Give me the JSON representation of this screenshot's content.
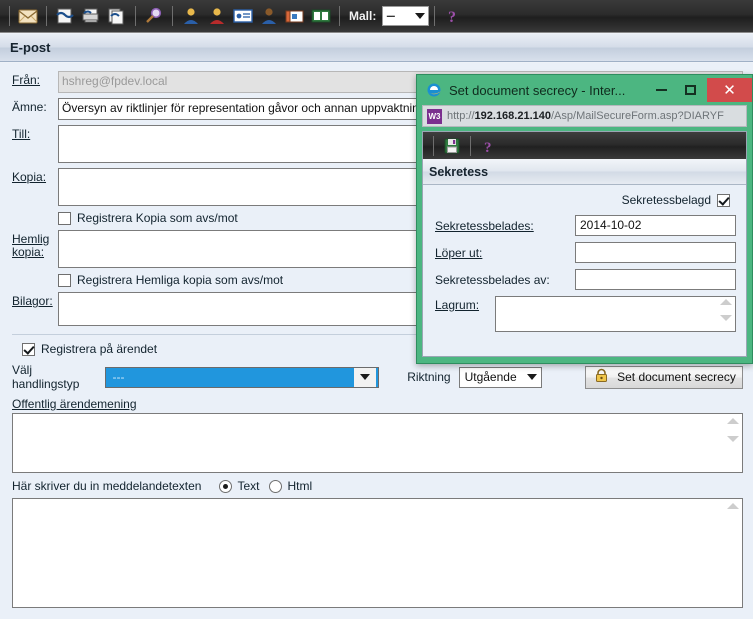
{
  "toolbar": {
    "icons": [
      {
        "name": "mail-icon",
        "title": "E-post"
      },
      {
        "name": "document-link-icon",
        "title": "Handling"
      },
      {
        "name": "document-print-icon",
        "title": "Skriv ut"
      },
      {
        "name": "documents-copy-icon",
        "title": "Kopiera"
      },
      {
        "name": "search-icon",
        "title": "Sök"
      },
      {
        "name": "user-blue-icon",
        "title": "Person"
      },
      {
        "name": "user-red-icon",
        "title": "Person"
      },
      {
        "name": "contact-card-icon",
        "title": "Kontaktkort"
      },
      {
        "name": "user-avatar-icon",
        "title": "Användare"
      },
      {
        "name": "cards-stack-icon",
        "title": "Register"
      },
      {
        "name": "book-icon",
        "title": "Katalog"
      }
    ],
    "mall_label": "Mall:",
    "mall_value": "---",
    "help_icon": "help-question-icon"
  },
  "panel": {
    "title": "E-post"
  },
  "form": {
    "fran_label": "Från:",
    "fran_value": "hshreg@fpdev.local",
    "amne_label": "Ämne:",
    "amne_value": "Översyn av riktlinjer för representation gåvor och annan uppvaktning frå",
    "till_label": "Till:",
    "till_value": "",
    "kopia_label": "Kopia:",
    "kopia_value": "",
    "reg_kopia_label": "Registrera Kopia som avs/mot",
    "reg_kopia_checked": false,
    "hemlig_kopia_label_1": "Hemlig",
    "hemlig_kopia_label_2": "kopia:",
    "hemlig_kopia_value": "",
    "reg_hemlig_label": "Registrera Hemliga kopia som avs/mot",
    "reg_hemlig_checked": false,
    "bilagor_label": "Bilagor:",
    "bilagor_value": "",
    "registrera_arendet_label": "Registrera på ärendet",
    "registrera_arendet_checked": true,
    "valj_handlingstyp_label": "Välj handlingstyp",
    "valj_handlingstyp_value": "---",
    "riktning_label": "Riktning",
    "riktning_value": "Utgående",
    "set_secrecy_button": "Set document secrecy",
    "set_secrecy_icon": "lock-icon",
    "offentlig_label": "Offentlig ärendemening",
    "offentlig_value": "",
    "meddelande_label": "Här skriver du in meddelandetexten",
    "format_text_label": "Text",
    "format_html_label": "Html",
    "format_selected": "Text",
    "meddelande_value": ""
  },
  "dialog": {
    "title": "Set document secrecy - Inter...",
    "browser_icon": "internet-explorer-icon",
    "minimize_icon": "minimize-icon",
    "maximize_icon": "maximize-icon",
    "close_icon": "close-icon",
    "url_icon": "w3-page-icon",
    "url_prefix": "http://",
    "url_host": "192.168.21.140",
    "url_path": "/Asp/MailSecureForm.asp?DIARYF",
    "toolbar": {
      "save_icon": "save-floppy-icon",
      "help_icon": "help-question-icon"
    },
    "section_title": "Sekretess",
    "sekretessbelagd_label": "Sekretessbelagd",
    "sekretessbelagd_checked": true,
    "sekretessbelades_label": "Sekretessbelades:",
    "sekretessbelades_value": "2014-10-02",
    "loper_ut_label": "Löper ut:",
    "loper_ut_value": "",
    "belades_av_label": "Sekretessbelades av:",
    "belades_av_value": "",
    "lagrum_label": "Lagrum:",
    "lagrum_value": ""
  },
  "colors": {
    "dialog_frame": "#4cb681",
    "close_button": "#d24b4b",
    "select_highlight": "#2196dd",
    "form_background": "#eaf0f8"
  }
}
